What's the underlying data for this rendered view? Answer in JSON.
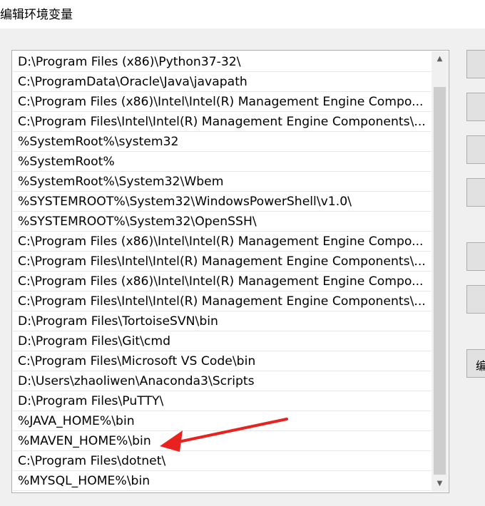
{
  "window": {
    "title": "编辑环境变量"
  },
  "path_list": {
    "items": [
      "D:\\Program Files (x86)\\Python37-32\\",
      "C:\\ProgramData\\Oracle\\Java\\javapath",
      "C:\\Program Files (x86)\\Intel\\Intel(R) Management Engine Compo...",
      "C:\\Program Files\\Intel\\Intel(R) Management Engine Components\\...",
      "%SystemRoot%\\system32",
      "%SystemRoot%",
      "%SystemRoot%\\System32\\Wbem",
      "%SYSTEMROOT%\\System32\\WindowsPowerShell\\v1.0\\",
      "%SYSTEMROOT%\\System32\\OpenSSH\\",
      "C:\\Program Files (x86)\\Intel\\Intel(R) Management Engine Compo...",
      "C:\\Program Files\\Intel\\Intel(R) Management Engine Components\\...",
      "C:\\Program Files (x86)\\Intel\\Intel(R) Management Engine Compo...",
      "C:\\Program Files\\Intel\\Intel(R) Management Engine Components\\...",
      "D:\\Program Files\\TortoiseSVN\\bin",
      "D:\\Program Files\\Git\\cmd",
      "C:\\Program Files\\Microsoft VS Code\\bin",
      "D:\\Users\\zhaoliwen\\Anaconda3\\Scripts",
      "D:\\Program Files\\PuTTY\\",
      "%JAVA_HOME%\\bin",
      "%MAVEN_HOME%\\bin",
      "C:\\Program Files\\dotnet\\",
      "%MYSQL_HOME%\\bin"
    ]
  },
  "side_buttons": {
    "edit_text_label": "编"
  },
  "annotation": {
    "color": "#e8231f"
  },
  "icons": {
    "scroll_up": "▲",
    "scroll_down": "▼"
  }
}
